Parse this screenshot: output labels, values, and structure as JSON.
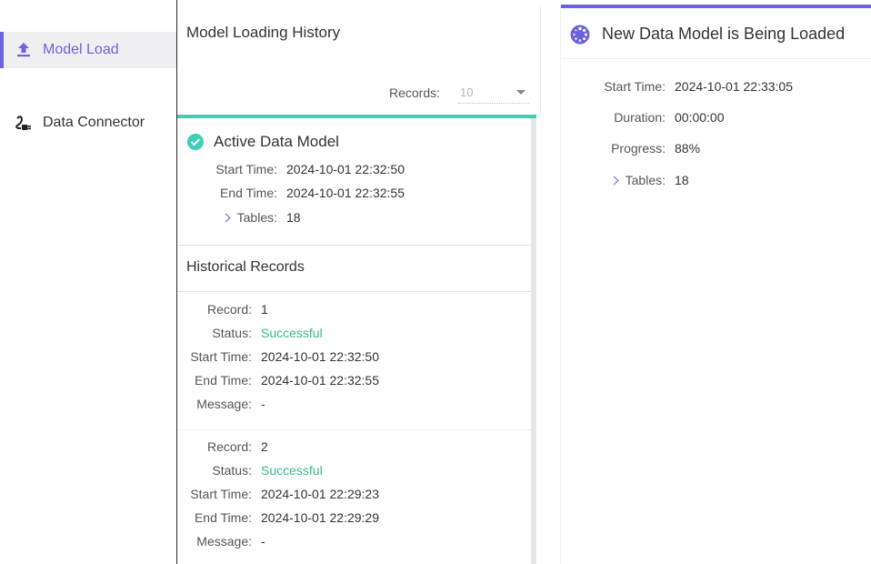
{
  "sidebar": {
    "items": [
      {
        "label": "Model Load",
        "icon": "upload-icon",
        "active": true
      },
      {
        "label": "Data Connector",
        "icon": "plug-icon",
        "active": false
      }
    ]
  },
  "history": {
    "title": "Model Loading History",
    "records_label": "Records:",
    "records_value": "10"
  },
  "active_model": {
    "title": "Active Data Model",
    "start_time_label": "Start Time:",
    "start_time": "2024-10-01 22:32:50",
    "end_time_label": "End Time:",
    "end_time": "2024-10-01 22:32:55",
    "tables_label": "Tables:",
    "tables": "18"
  },
  "historical": {
    "title": "Historical Records",
    "labels": {
      "record": "Record:",
      "status": "Status:",
      "start_time": "Start Time:",
      "end_time": "End Time:",
      "message": "Message:"
    },
    "records": [
      {
        "record": "1",
        "status": "Successful",
        "start_time": "2024-10-01 22:32:50",
        "end_time": "2024-10-01 22:32:55",
        "message": "-"
      },
      {
        "record": "2",
        "status": "Successful",
        "start_time": "2024-10-01 22:29:23",
        "end_time": "2024-10-01 22:29:29",
        "message": "-"
      }
    ]
  },
  "loading": {
    "title": "New Data Model is Being Loaded",
    "start_time_label": "Start Time:",
    "start_time": "2024-10-01 22:33:05",
    "duration_label": "Duration:",
    "duration": "00:00:00",
    "progress_label": "Progress:",
    "progress": "88%",
    "tables_label": "Tables:",
    "tables": "18"
  },
  "colors": {
    "accent": "#6c63e0",
    "teal": "#3ecfb4",
    "success": "#3ab88e"
  }
}
